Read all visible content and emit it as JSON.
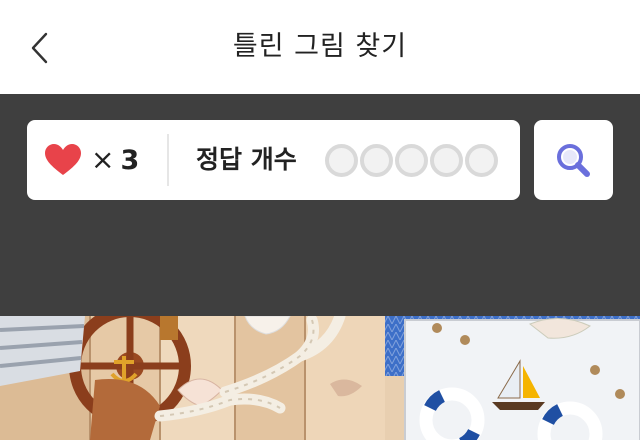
{
  "header": {
    "title": "틀린 그림 찾기",
    "back_icon": "chevron-left-icon"
  },
  "status": {
    "lives_icon": "heart-icon",
    "lives_prefix": "×",
    "lives_count": "3",
    "answers_label": "정답 개수",
    "answers_found": 0,
    "answers_total": 5,
    "search_icon": "magnifier-icon"
  },
  "colors": {
    "heart": "#e8434a",
    "panel_bg": "#3f3f3f",
    "search_accent": "#6a6fdc",
    "slot_empty": "#d9d9d9"
  }
}
